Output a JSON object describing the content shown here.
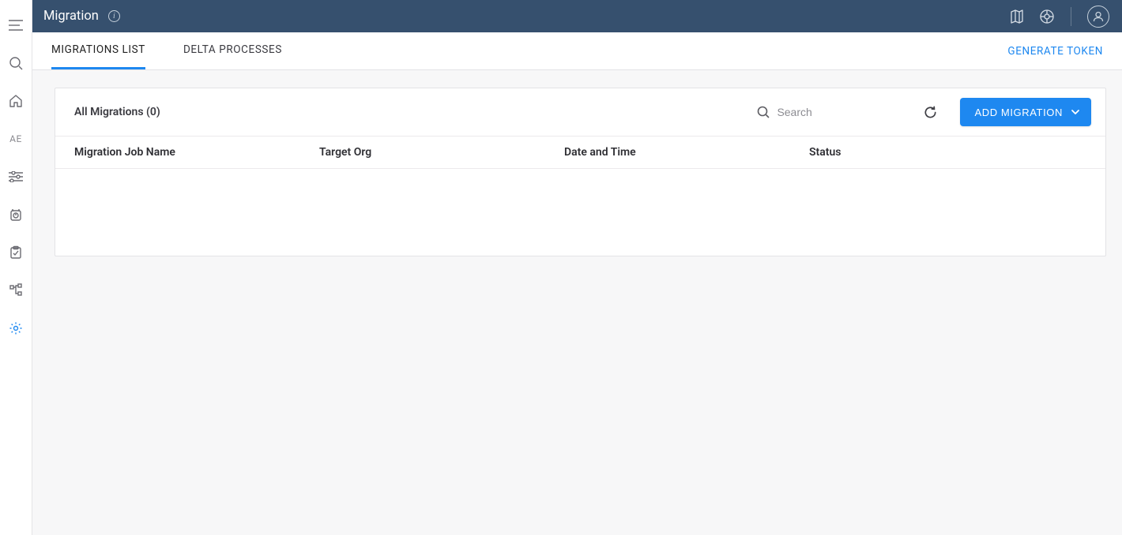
{
  "header": {
    "title": "Migration"
  },
  "sidebar": {
    "ae_label": "AE"
  },
  "tabs": {
    "items": [
      {
        "label": "MIGRATIONS LIST",
        "active": true
      },
      {
        "label": "DELTA PROCESSES",
        "active": false
      }
    ],
    "generate_token_label": "GENERATE TOKEN"
  },
  "panel": {
    "title_prefix": "All Migrations",
    "count": 0,
    "title": "All Migrations (0)",
    "search_placeholder": "Search",
    "add_button_label": "ADD MIGRATION"
  },
  "table": {
    "columns": [
      "Migration Job Name",
      "Target Org",
      "Date and Time",
      "Status"
    ],
    "rows": []
  },
  "colors": {
    "header_bg": "#36506e",
    "accent": "#1e88f0"
  }
}
